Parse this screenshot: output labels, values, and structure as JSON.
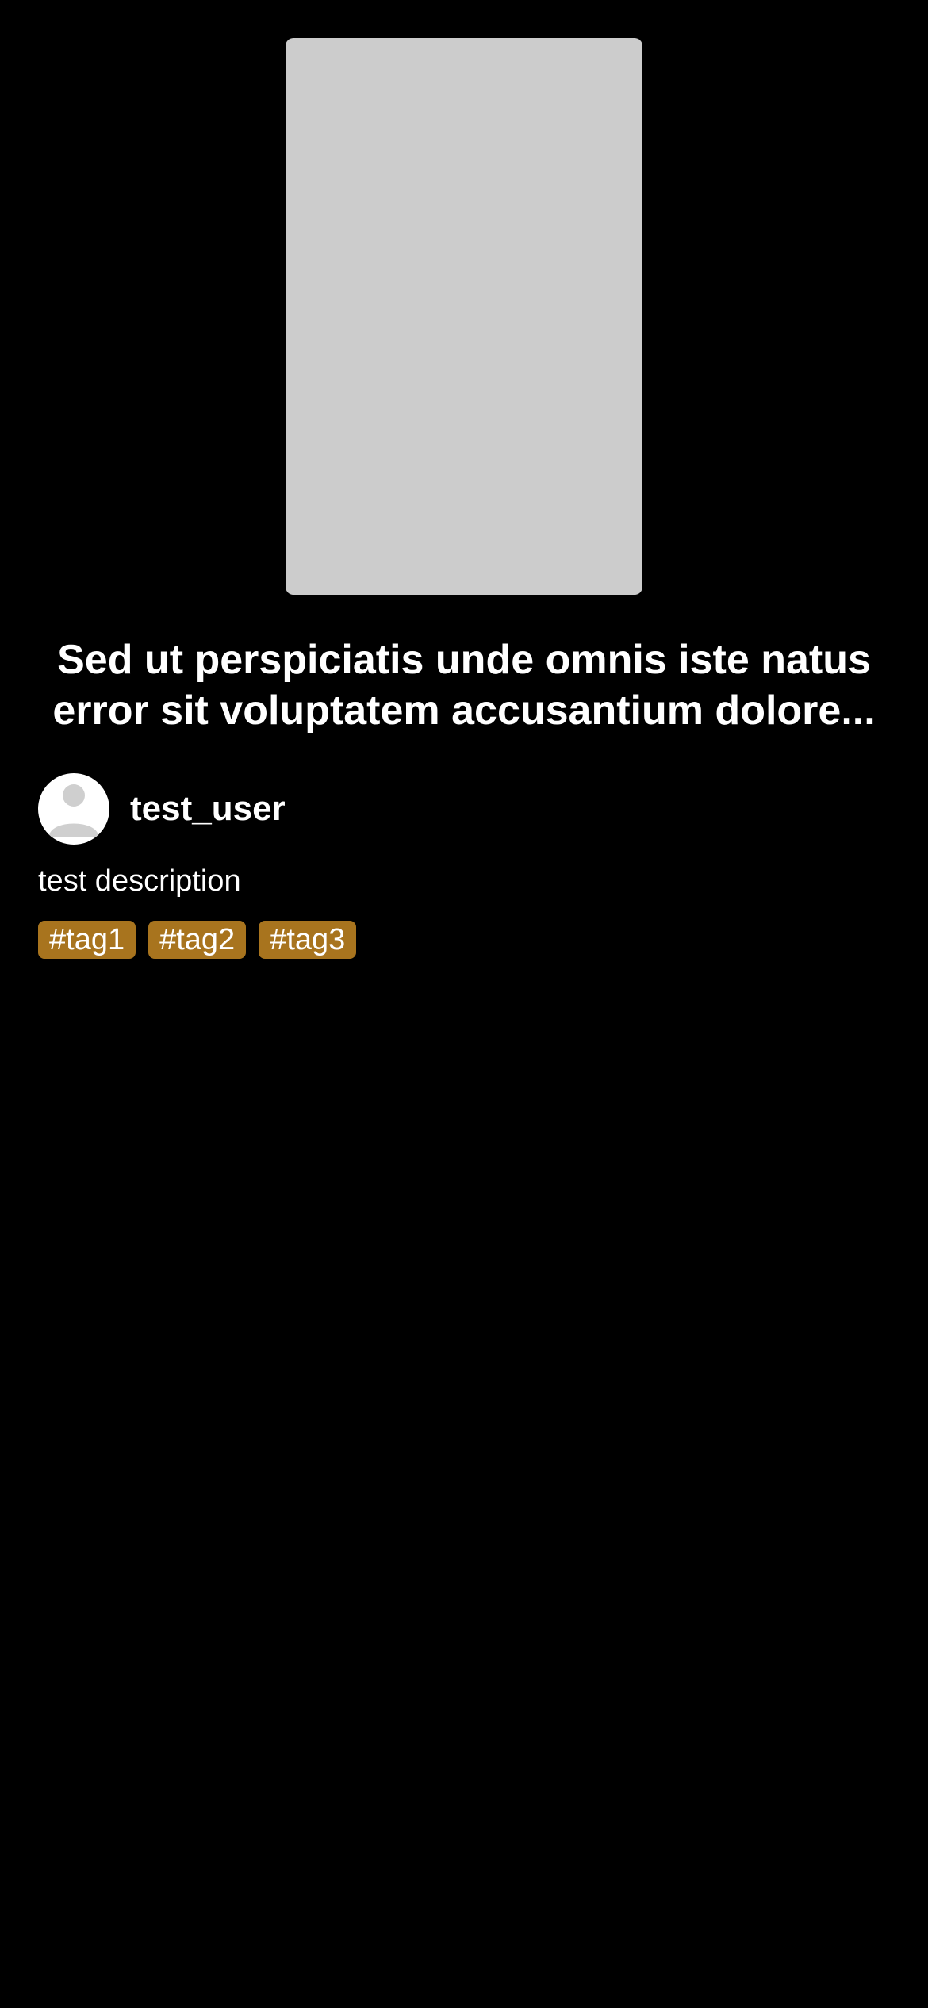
{
  "post": {
    "title": "Sed ut perspiciatis unde omnis iste natus error sit voluptatem accusantium dolore...",
    "author": {
      "username": "test_user",
      "avatar_icon": "user-avatar-icon"
    },
    "description": "test description",
    "tags": [
      "#tag1",
      "#tag2",
      "#tag3"
    ]
  },
  "colors": {
    "background": "#000000",
    "thumbnail_placeholder": "#cccccc",
    "tag_background": "#a8741e",
    "text": "#ffffff"
  }
}
